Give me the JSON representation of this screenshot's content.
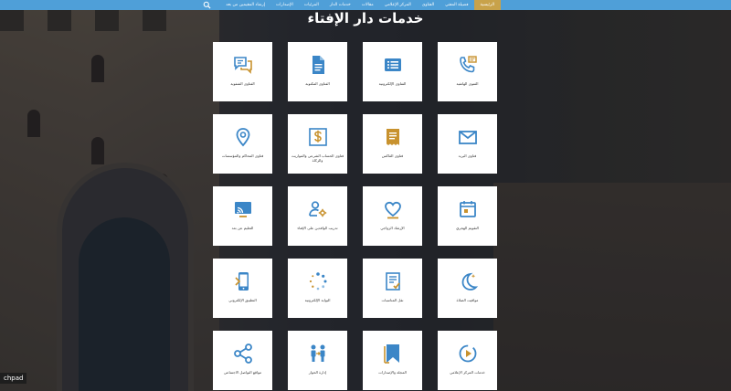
{
  "nav": {
    "items": [
      {
        "label": "الرئيسية",
        "active": true
      },
      {
        "label": "فضيلة المفتي",
        "active": false
      },
      {
        "label": "الفتاوى",
        "active": false
      },
      {
        "label": "المركز الإعلامي",
        "active": false
      },
      {
        "label": "مقالات",
        "active": false
      },
      {
        "label": "خدمات الدار",
        "active": false
      },
      {
        "label": "المرئيات",
        "active": false
      },
      {
        "label": "الإصدارات",
        "active": false
      },
      {
        "label": "إرشاد المقيمين من بعد",
        "active": false
      }
    ],
    "search_icon": "search-icon",
    "bar_color": "#4f9fd8",
    "active_color": "#c8a24a"
  },
  "page": {
    "title": "خدمات دار الإفتاء"
  },
  "colors": {
    "icon_blue": "#3b86c7",
    "icon_gold": "#c8922e"
  },
  "services": [
    {
      "label": "الفتوى الهاتفية",
      "icon": "phone-icon"
    },
    {
      "label": "الفتاوى الإلكترونية",
      "icon": "list-icon"
    },
    {
      "label": "الفتاوى المكتوبة",
      "icon": "document-icon"
    },
    {
      "label": "الفتاوى الشفوية",
      "icon": "chat-icon"
    },
    {
      "label": "فتاوى البريد",
      "icon": "mail-icon"
    },
    {
      "label": "فتاوى الفاكس",
      "icon": "fax-icon"
    },
    {
      "label": "فتاوى الحساب الشرعي والمواريث والزكاة",
      "icon": "dollar-icon"
    },
    {
      "label": "فتاوى المحاكم والمؤسسات",
      "icon": "location-icon"
    },
    {
      "label": "التقويم الهجري",
      "icon": "calendar-icon"
    },
    {
      "label": "الإرشاد الزواجي",
      "icon": "heart-icon"
    },
    {
      "label": "تدريب الوافدين على الإفتاء",
      "icon": "user-gear-icon"
    },
    {
      "label": "التعليم عن بعد",
      "icon": "cast-icon"
    },
    {
      "label": "مواقيت الصلاة",
      "icon": "moon-icon"
    },
    {
      "label": "نقل المناسبات",
      "icon": "checklist-icon"
    },
    {
      "label": "البوابة الإلكترونية",
      "icon": "loading-icon"
    },
    {
      "label": "التطبيق الإلكتروني",
      "icon": "mobile-icon"
    },
    {
      "label": "خدمات المركز الإعلامي",
      "icon": "play-icon"
    },
    {
      "label": "المجلة والإصدارات",
      "icon": "bookmark-icon"
    },
    {
      "label": "إدارة الحوار",
      "icon": "people-icon"
    },
    {
      "label": "مواقع التواصل الاجتماعي",
      "icon": "share-icon"
    }
  ],
  "overlay_label": "chpad"
}
